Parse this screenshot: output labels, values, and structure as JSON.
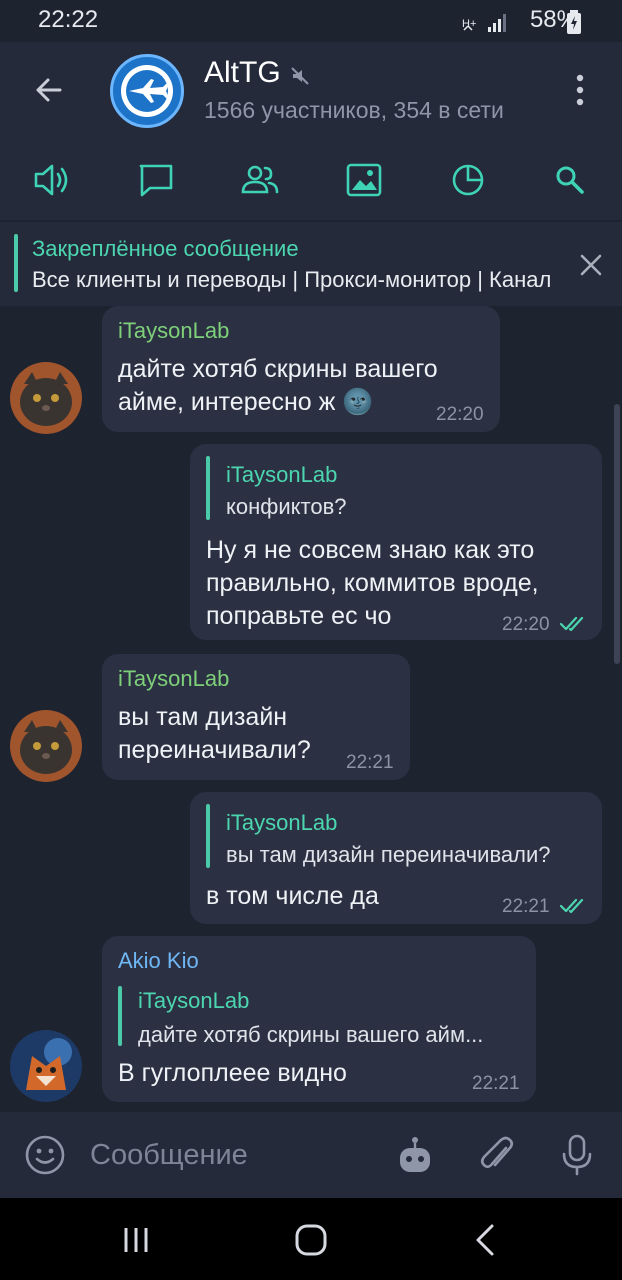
{
  "status_bar": {
    "time": "22:22",
    "battery": "58%"
  },
  "header": {
    "title": "AltTG",
    "subtitle": "1566 участников, 354 в сети",
    "icons": [
      "back-arrow-icon",
      "muted-icon",
      "more-vert-icon"
    ]
  },
  "tabs": [
    "speaker-icon",
    "chat-bubble-icon",
    "members-icon",
    "media-icon",
    "pie-chart-icon",
    "search-icon"
  ],
  "pinned": {
    "title": "Закреплённое сообщение",
    "text": "Все клиенты и переводы | Прокси-монитор | Каналы"
  },
  "messages": [
    {
      "sender": "iTaysonLab",
      "lines": [
        "дайте хотяб скрины вашего",
        "айме, интересно ж 🌚"
      ],
      "time": "22:20",
      "direction": "in"
    },
    {
      "reply_to": {
        "name": "iTaysonLab",
        "text": "конфиктов?"
      },
      "lines": [
        "Ну я не совсем знаю как это",
        "правильно, коммитов вроде,",
        "поправьте ес чо"
      ],
      "time": "22:20",
      "direction": "out"
    },
    {
      "sender": "iTaysonLab",
      "lines": [
        "вы там дизайн",
        "переиначивали?"
      ],
      "time": "22:21",
      "direction": "in"
    },
    {
      "reply_to": {
        "name": "iTaysonLab",
        "text": "вы там дизайн переиначивали?"
      },
      "lines": [
        "в том числе да"
      ],
      "time": "22:21",
      "direction": "out"
    },
    {
      "sender": "Akio Kio",
      "reply_to": {
        "name": "iTaysonLab",
        "text": "дайте хотяб скрины вашего айм..."
      },
      "lines": [
        "В гуглоплеее видно"
      ],
      "time": "22:21",
      "direction": "in"
    }
  ],
  "composer": {
    "placeholder": "Сообщение"
  },
  "colors": {
    "accent": "#4cd6b0",
    "sender_green": "#7ed07a",
    "sender_blue": "#6fb6f5",
    "bubble": "#2b3142",
    "background": "#1e2330",
    "bar": "#252a3a"
  }
}
